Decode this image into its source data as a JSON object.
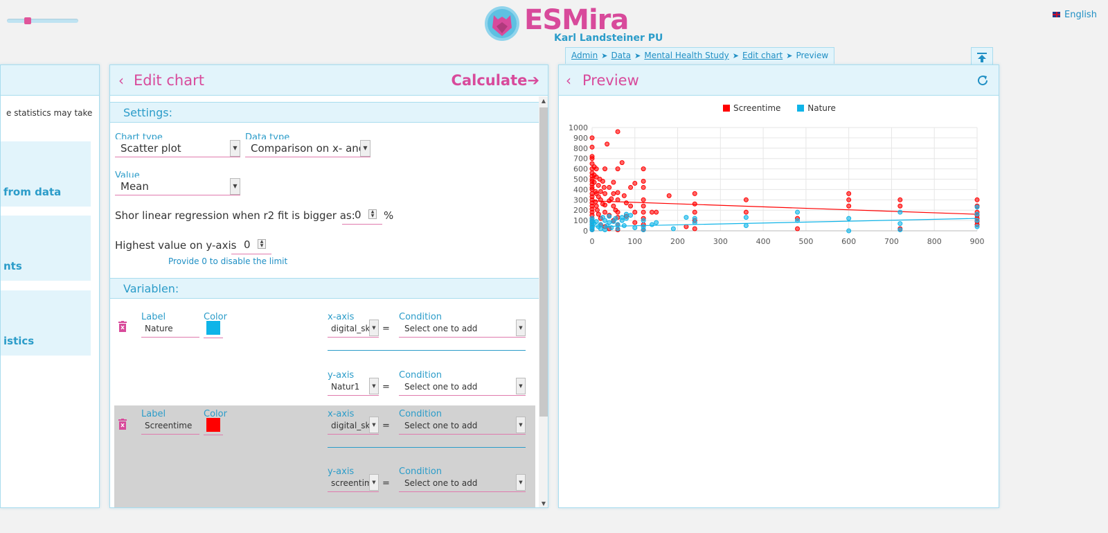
{
  "app": {
    "brand": "ESMira",
    "organization": "Karl Landsteiner PU",
    "language": "English"
  },
  "breadcrumbs": [
    "Admin",
    "Data",
    "Mental Health Study",
    "Edit chart"
  ],
  "breadcrumb_current": "Preview",
  "left_panel": {
    "note": "e statistics may take",
    "tiles": [
      "from data",
      "nts",
      "istics"
    ]
  },
  "edit_chart": {
    "title": "Edit chart",
    "calculate_label": "Calculate",
    "settings_title": "Settings:",
    "chart_type_label": "Chart type",
    "chart_type_value": "Scatter plot",
    "data_type_label": "Data type",
    "data_type_value": "Comparison on x- and",
    "value_label": "Value",
    "value_value": "Mean",
    "regression_label": "Shor linear regression when r2 fit is bigger as:",
    "regression_value": "0",
    "regression_unit": "%",
    "ymax_label": "Highest value on y-axis",
    "ymax_value": "0",
    "ymax_hint": "Provide 0 to disable the limit",
    "variables_title": "Variablen:",
    "col_label": "Label",
    "col_color": "Color",
    "col_x": "x-axis",
    "col_y": "y-axis",
    "col_condition": "Condition",
    "condition_placeholder": "Select one to add",
    "variables": [
      {
        "label": "Nature",
        "color": "#0fb4e8",
        "x_var": "digital_sk",
        "y_var": "Natur1"
      },
      {
        "label": "Screentime",
        "color": "#ff0000",
        "x_var": "digital_sk",
        "y_var": "screentim"
      }
    ]
  },
  "preview": {
    "title": "Preview"
  },
  "chart_data": {
    "type": "scatter",
    "xlim": [
      0,
      900
    ],
    "ylim": [
      0,
      1000
    ],
    "x_ticks": [
      0,
      100,
      200,
      300,
      400,
      500,
      600,
      700,
      800,
      900
    ],
    "y_ticks": [
      0,
      100,
      200,
      300,
      400,
      500,
      600,
      700,
      800,
      900,
      1000
    ],
    "legend_position": "top",
    "grid": true,
    "series": [
      {
        "name": "Screentime",
        "color": "#ff0000",
        "regression": [
          [
            0,
            290
          ],
          [
            900,
            160
          ]
        ],
        "points": [
          [
            0,
            900
          ],
          [
            0,
            810
          ],
          [
            0,
            720
          ],
          [
            0,
            700
          ],
          [
            0,
            650
          ],
          [
            0,
            600
          ],
          [
            0,
            560
          ],
          [
            0,
            530
          ],
          [
            0,
            500
          ],
          [
            0,
            480
          ],
          [
            0,
            450
          ],
          [
            0,
            420
          ],
          [
            0,
            400
          ],
          [
            0,
            360
          ],
          [
            0,
            330
          ],
          [
            0,
            300
          ],
          [
            0,
            270
          ],
          [
            0,
            240
          ],
          [
            0,
            210
          ],
          [
            0,
            180
          ],
          [
            0,
            150
          ],
          [
            0,
            120
          ],
          [
            0,
            90
          ],
          [
            0,
            60
          ],
          [
            0,
            30
          ],
          [
            0,
            10
          ],
          [
            5,
            620
          ],
          [
            5,
            540
          ],
          [
            5,
            470
          ],
          [
            8,
            380
          ],
          [
            8,
            280
          ],
          [
            10,
            600
          ],
          [
            10,
            520
          ],
          [
            10,
            360
          ],
          [
            10,
            240
          ],
          [
            12,
            200
          ],
          [
            15,
            440
          ],
          [
            15,
            330
          ],
          [
            15,
            160
          ],
          [
            18,
            500
          ],
          [
            20,
            380
          ],
          [
            20,
            300
          ],
          [
            20,
            120
          ],
          [
            20,
            60
          ],
          [
            25,
            480
          ],
          [
            25,
            260
          ],
          [
            28,
            420
          ],
          [
            30,
            600
          ],
          [
            30,
            360
          ],
          [
            30,
            250
          ],
          [
            30,
            180
          ],
          [
            30,
            40
          ],
          [
            35,
            840
          ],
          [
            40,
            420
          ],
          [
            40,
            290
          ],
          [
            40,
            150
          ],
          [
            40,
            20
          ],
          [
            45,
            310
          ],
          [
            50,
            470
          ],
          [
            50,
            360
          ],
          [
            50,
            240
          ],
          [
            50,
            100
          ],
          [
            55,
            200
          ],
          [
            60,
            960
          ],
          [
            60,
            600
          ],
          [
            60,
            370
          ],
          [
            60,
            300
          ],
          [
            60,
            180
          ],
          [
            60,
            130
          ],
          [
            60,
            60
          ],
          [
            60,
            10
          ],
          [
            70,
            660
          ],
          [
            75,
            340
          ],
          [
            80,
            270
          ],
          [
            80,
            140
          ],
          [
            90,
            420
          ],
          [
            90,
            240
          ],
          [
            100,
            460
          ],
          [
            100,
            180
          ],
          [
            100,
            80
          ],
          [
            120,
            600
          ],
          [
            120,
            480
          ],
          [
            120,
            420
          ],
          [
            120,
            300
          ],
          [
            120,
            240
          ],
          [
            120,
            180
          ],
          [
            120,
            120
          ],
          [
            120,
            60
          ],
          [
            120,
            10
          ],
          [
            140,
            180
          ],
          [
            150,
            180
          ],
          [
            180,
            340
          ],
          [
            220,
            40
          ],
          [
            240,
            360
          ],
          [
            240,
            260
          ],
          [
            240,
            180
          ],
          [
            240,
            100
          ],
          [
            240,
            20
          ],
          [
            360,
            300
          ],
          [
            360,
            180
          ],
          [
            480,
            120
          ],
          [
            480,
            20
          ],
          [
            600,
            360
          ],
          [
            600,
            300
          ],
          [
            600,
            240
          ],
          [
            720,
            300
          ],
          [
            720,
            240
          ],
          [
            720,
            20
          ],
          [
            900,
            300
          ],
          [
            900,
            240
          ],
          [
            900,
            180
          ],
          [
            900,
            150
          ],
          [
            900,
            120
          ],
          [
            900,
            90
          ],
          [
            900,
            60
          ]
        ]
      },
      {
        "name": "Nature",
        "color": "#0fb4e8",
        "regression": [
          [
            0,
            40
          ],
          [
            900,
            120
          ]
        ],
        "points": [
          [
            0,
            120
          ],
          [
            0,
            100
          ],
          [
            0,
            80
          ],
          [
            0,
            60
          ],
          [
            0,
            40
          ],
          [
            0,
            20
          ],
          [
            0,
            10
          ],
          [
            5,
            70
          ],
          [
            10,
            90
          ],
          [
            15,
            40
          ],
          [
            20,
            60
          ],
          [
            20,
            20
          ],
          [
            25,
            130
          ],
          [
            30,
            100
          ],
          [
            30,
            10
          ],
          [
            35,
            50
          ],
          [
            40,
            140
          ],
          [
            40,
            80
          ],
          [
            45,
            30
          ],
          [
            50,
            90
          ],
          [
            55,
            120
          ],
          [
            60,
            60
          ],
          [
            60,
            20
          ],
          [
            70,
            130
          ],
          [
            70,
            100
          ],
          [
            75,
            50
          ],
          [
            80,
            160
          ],
          [
            80,
            120
          ],
          [
            90,
            150
          ],
          [
            100,
            30
          ],
          [
            120,
            100
          ],
          [
            120,
            40
          ],
          [
            120,
            10
          ],
          [
            140,
            60
          ],
          [
            150,
            80
          ],
          [
            190,
            20
          ],
          [
            220,
            130
          ],
          [
            240,
            120
          ],
          [
            240,
            80
          ],
          [
            360,
            130
          ],
          [
            360,
            50
          ],
          [
            480,
            180
          ],
          [
            480,
            100
          ],
          [
            600,
            120
          ],
          [
            600,
            0
          ],
          [
            720,
            180
          ],
          [
            720,
            70
          ],
          [
            720,
            10
          ],
          [
            900,
            230
          ],
          [
            900,
            160
          ],
          [
            900,
            100
          ],
          [
            900,
            40
          ]
        ]
      }
    ]
  }
}
